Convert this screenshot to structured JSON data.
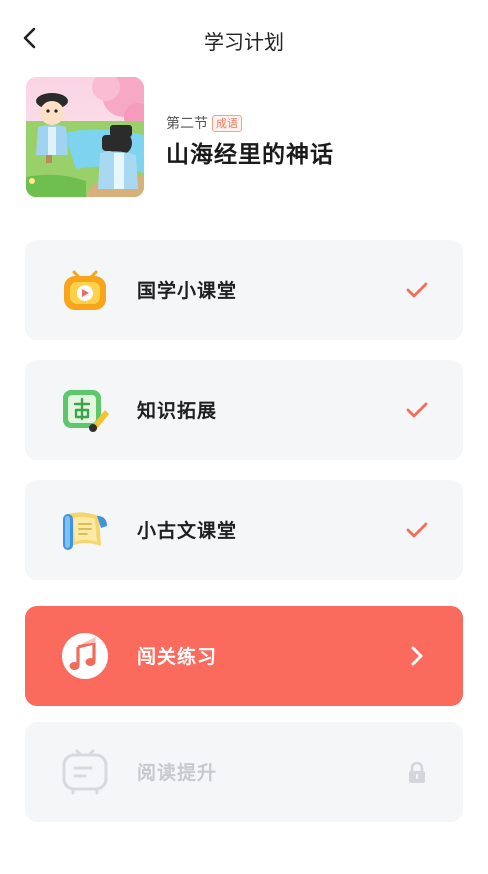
{
  "header": {
    "title": "学习计划",
    "back_icon": "chevron-left-icon"
  },
  "lesson": {
    "section": "第二节",
    "tag": "成语",
    "title": "山海经里的神话"
  },
  "steps": [
    {
      "label": "国学小课堂",
      "icon": "tv-play-icon",
      "status": "completed",
      "status_icon": "check-icon"
    },
    {
      "label": "知识拓展",
      "icon": "ancient-board-icon",
      "status": "completed",
      "status_icon": "check-icon"
    },
    {
      "label": "小古文课堂",
      "icon": "scroll-icon",
      "status": "completed",
      "status_icon": "check-icon"
    },
    {
      "label": "闯关练习",
      "icon": "music-note-icon",
      "status": "current",
      "status_icon": "chevron-right-icon"
    },
    {
      "label": "阅读提升",
      "icon": "reading-book-icon",
      "status": "locked",
      "status_icon": "lock-icon"
    }
  ],
  "colors": {
    "accent": "#fa6a5d",
    "check": "#f26b5b",
    "card_bg": "#f5f6f8",
    "locked": "#c7c9ce"
  }
}
